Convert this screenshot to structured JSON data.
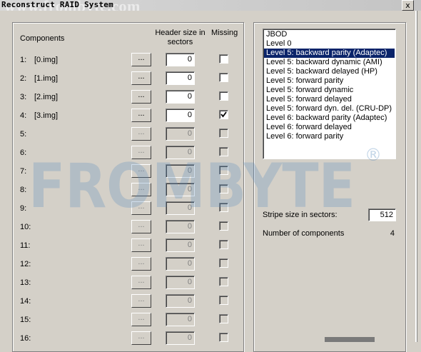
{
  "window": {
    "title": "Reconstruct RAID System",
    "watermark_url": "www.frombyte.com",
    "close_glyph": "x"
  },
  "components": {
    "header_components": "Components",
    "header_size": "Header size in sectors",
    "header_missing": "Missing",
    "browse_label": "...",
    "rows": [
      {
        "num": "1:",
        "name": "[0.img]",
        "header_size": "0",
        "missing": false,
        "enabled": true
      },
      {
        "num": "2:",
        "name": "[1.img]",
        "header_size": "0",
        "missing": false,
        "enabled": true
      },
      {
        "num": "3:",
        "name": "[2.img]",
        "header_size": "0",
        "missing": false,
        "enabled": true
      },
      {
        "num": "4:",
        "name": "[3.img]",
        "header_size": "0",
        "missing": true,
        "enabled": true
      },
      {
        "num": "5:",
        "name": "",
        "header_size": "0",
        "missing": false,
        "enabled": false
      },
      {
        "num": "6:",
        "name": "",
        "header_size": "0",
        "missing": false,
        "enabled": false
      },
      {
        "num": "7:",
        "name": "",
        "header_size": "0",
        "missing": false,
        "enabled": false
      },
      {
        "num": "8:",
        "name": "",
        "header_size": "0",
        "missing": false,
        "enabled": false
      },
      {
        "num": "9:",
        "name": "",
        "header_size": "0",
        "missing": false,
        "enabled": false
      },
      {
        "num": "10:",
        "name": "",
        "header_size": "0",
        "missing": false,
        "enabled": false
      },
      {
        "num": "11:",
        "name": "",
        "header_size": "0",
        "missing": false,
        "enabled": false
      },
      {
        "num": "12:",
        "name": "",
        "header_size": "0",
        "missing": false,
        "enabled": false
      },
      {
        "num": "13:",
        "name": "",
        "header_size": "0",
        "missing": false,
        "enabled": false
      },
      {
        "num": "14:",
        "name": "",
        "header_size": "0",
        "missing": false,
        "enabled": false
      },
      {
        "num": "15:",
        "name": "",
        "header_size": "0",
        "missing": false,
        "enabled": false
      },
      {
        "num": "16:",
        "name": "",
        "header_size": "0",
        "missing": false,
        "enabled": false
      }
    ]
  },
  "raid": {
    "levels": [
      "JBOD",
      "Level 0",
      "Level 5: backward parity (Adaptec)",
      "Level 5: backward dynamic (AMI)",
      "Level 5: backward delayed (HP)",
      "Level 5: forward parity",
      "Level 5: forward dynamic",
      "Level 5: forward delayed",
      "Level 5: forward dyn. del. (CRU-DP)",
      "Level 6: backward parity (Adaptec)",
      "Level 6: forward delayed",
      "Level 6: forward parity"
    ],
    "selected_index": 2,
    "stripe_label": "Stripe size in sectors:",
    "stripe_value": "512",
    "ncomp_label": "Number of components",
    "ncomp_value": "4"
  },
  "watermark": {
    "logo_text": "FROMBYTE",
    "registered": "®"
  },
  "colors": {
    "window_bg": "#d4d0c8",
    "selection": "#0a246a",
    "watermark_logo": "#5a8cbe"
  }
}
